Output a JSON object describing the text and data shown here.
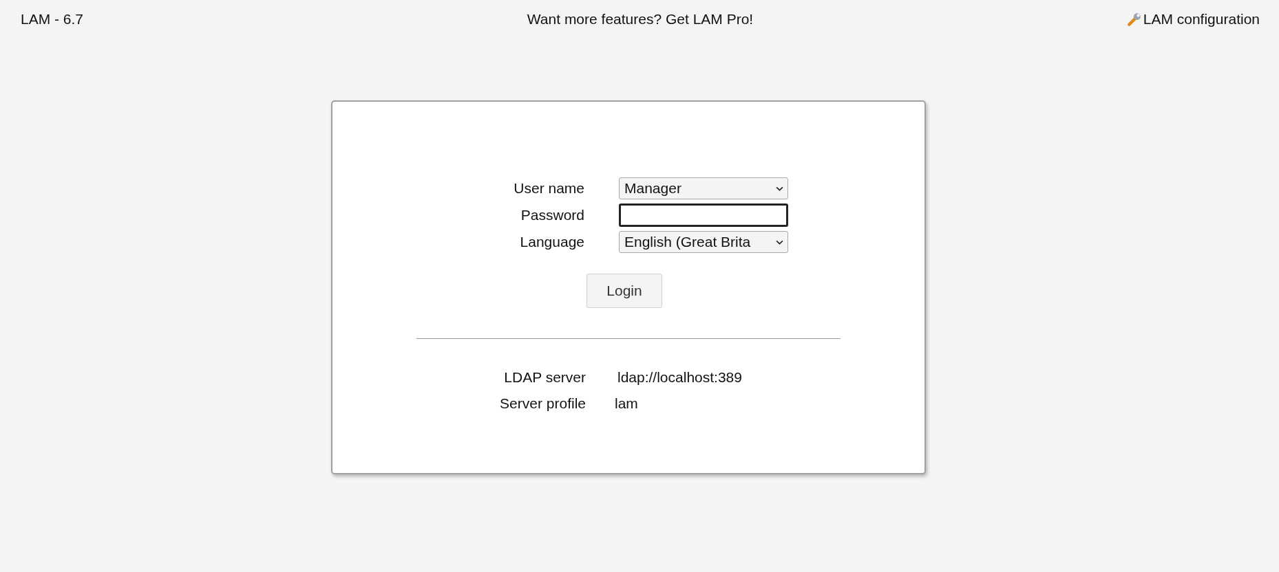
{
  "header": {
    "version": "LAM - 6.7",
    "promo": "Want more features? Get LAM Pro!",
    "config_link": "LAM configuration"
  },
  "login_form": {
    "fields": [
      {
        "label": "User name",
        "kind": "select",
        "value": "Manager",
        "focused": false
      },
      {
        "label": "Password",
        "kind": "password",
        "focused": true
      },
      {
        "label": "Language",
        "kind": "select",
        "value": "English (Great Brita",
        "focused": false
      }
    ],
    "login_button": "Login"
  },
  "server_info": [
    {
      "label": "LDAP server",
      "value": "ldap://localhost:389"
    },
    {
      "label": "Server profile",
      "value": "lam"
    }
  ]
}
